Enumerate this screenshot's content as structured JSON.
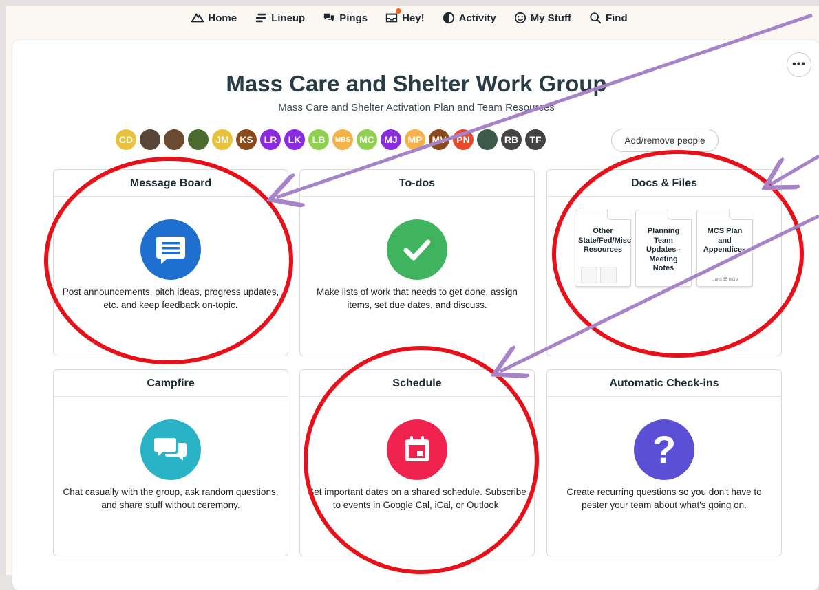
{
  "nav": {
    "home": "Home",
    "lineup": "Lineup",
    "pings": "Pings",
    "hey": "Hey!",
    "activity": "Activity",
    "my_stuff": "My Stuff",
    "find": "Find"
  },
  "project": {
    "title": "Mass Care and Shelter Work Group",
    "subtitle": "Mass Care and Shelter Activation Plan and Team Resources",
    "add_people": "Add/remove people"
  },
  "avatars": [
    {
      "initials": "CD",
      "color": "#e8c23a"
    },
    {
      "initials": "",
      "color": "#5a4636"
    },
    {
      "initials": "",
      "color": "#6b4a32"
    },
    {
      "initials": "",
      "color": "#4b6b2e"
    },
    {
      "initials": "JM",
      "color": "#e8c23a"
    },
    {
      "initials": "KS",
      "color": "#8b4a1c"
    },
    {
      "initials": "LR",
      "color": "#8a2be2"
    },
    {
      "initials": "LK",
      "color": "#8a2be2"
    },
    {
      "initials": "LB",
      "color": "#8fd14f"
    },
    {
      "initials": "MBS",
      "color": "#f5b24a"
    },
    {
      "initials": "MC",
      "color": "#8fd14f"
    },
    {
      "initials": "MJ",
      "color": "#8a2be2"
    },
    {
      "initials": "MP",
      "color": "#f5b24a"
    },
    {
      "initials": "MV",
      "color": "#8b4a1c"
    },
    {
      "initials": "PN",
      "color": "#e84a2c"
    },
    {
      "initials": "",
      "color": "#3d5a4a"
    },
    {
      "initials": "RB",
      "color": "#444444"
    },
    {
      "initials": "TF",
      "color": "#444444"
    }
  ],
  "tools": {
    "message_board": {
      "title": "Message Board",
      "desc": "Post announcements, pitch ideas, progress updates, etc. and keep feedback on-topic."
    },
    "todos": {
      "title": "To-dos",
      "desc": "Make lists of work that needs to get done, assign items, set due dates, and discuss."
    },
    "docs": {
      "title": "Docs & Files",
      "folders": [
        {
          "name": "Other State/Fed/Misc Resources"
        },
        {
          "name": "Planning Team Updates - Meeting Notes"
        },
        {
          "name": "MCS Plan and Appendices",
          "extra": "...and 35 more"
        }
      ]
    },
    "campfire": {
      "title": "Campfire",
      "desc": "Chat casually with the group, ask random questions, and share stuff without ceremony."
    },
    "schedule": {
      "title": "Schedule",
      "desc": "Set important dates on a shared schedule. Subscribe to events in Google Cal, iCal, or Outlook."
    },
    "checkins": {
      "title": "Automatic Check-ins",
      "desc": "Create recurring questions so you don't have to pester your team about what's going on."
    }
  },
  "colors": {
    "message_board": "#1f6fd1",
    "todos": "#3fb35e",
    "campfire": "#2ab3c7",
    "schedule": "#f0234f",
    "checkins": "#5b4fd6",
    "annotation_circle": "#e8111a",
    "annotation_arrow": "#a783c9"
  }
}
